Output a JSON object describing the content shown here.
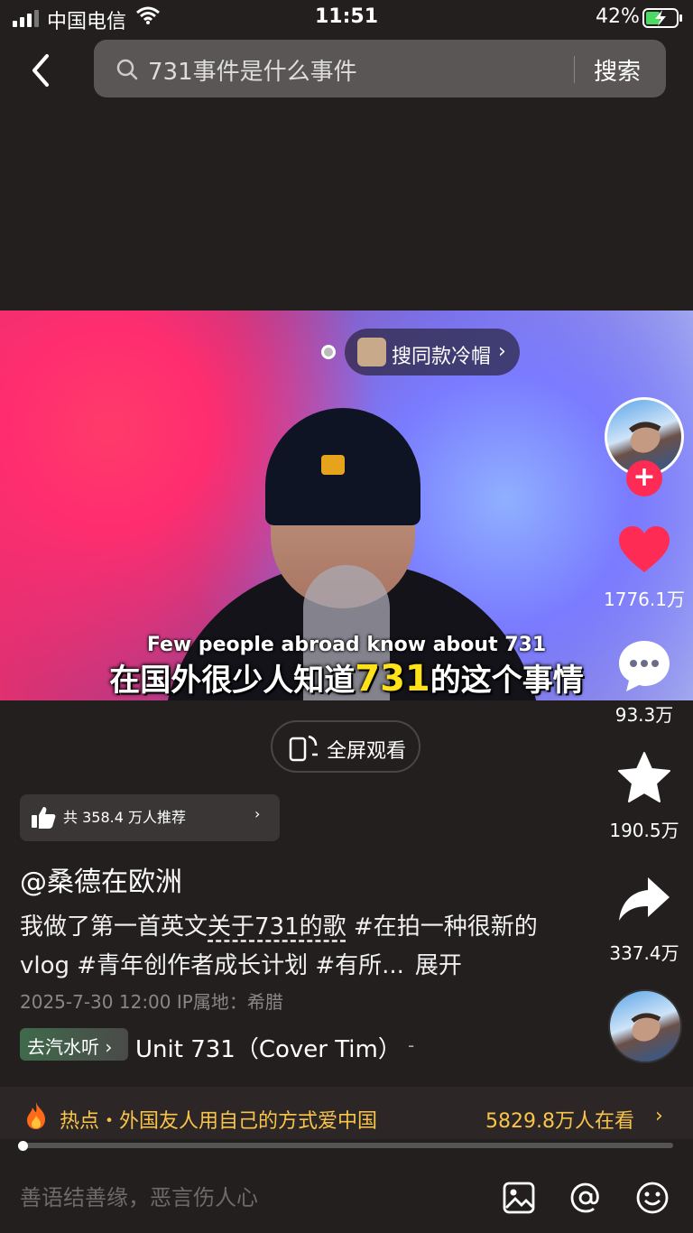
{
  "status_bar": {
    "carrier": "中国电信",
    "time": "11:51",
    "battery": "42%",
    "icons": [
      "signal-icon",
      "wifi-icon",
      "battery-charging-icon"
    ]
  },
  "search": {
    "query": "731事件是什么事件",
    "button_label": "搜索"
  },
  "video": {
    "product_pill": "搜同款冷帽",
    "subtitle_en": "Few people abroad know about 731",
    "subtitle_cn_before": "在国外很少人知道",
    "subtitle_cn_highlight": "731",
    "subtitle_cn_after": "的这个事情"
  },
  "actions": {
    "follow": "+",
    "likes": "1776.1万",
    "comments": "93.3万",
    "favorites": "190.5万",
    "shares": "337.4万"
  },
  "fullscreen_label": "全屏观看",
  "recommend": {
    "text": "共 358.4 万人推荐",
    "arrow": "›"
  },
  "post": {
    "author": "@桑德在欧洲",
    "desc_prefix": "我做了第一首英文",
    "desc_link": "关于731的歌",
    "desc_rest": " #在拍一种很新的 vlog #青年创作者成长计划 #有所...",
    "expand_label": "展开",
    "meta": "2025-7-30 12:00   IP属地：希腊"
  },
  "music": {
    "tag": "去汽水听 ›",
    "title": "Unit 731（Cover Tim）",
    "dot": "-"
  },
  "hot": {
    "text": "热点・外国友人用自己的方式爱中国",
    "views": "5829.8万人在看",
    "arrow": "›"
  },
  "progress": 0.0,
  "comment_input": {
    "placeholder": "善语结善缘，恶言伤人心"
  },
  "colors": {
    "background": "#231f1f",
    "accent_red": "#fe2c55",
    "hot_yellow": "#f8c44a",
    "subtitle_highlight": "#ffe21a"
  }
}
